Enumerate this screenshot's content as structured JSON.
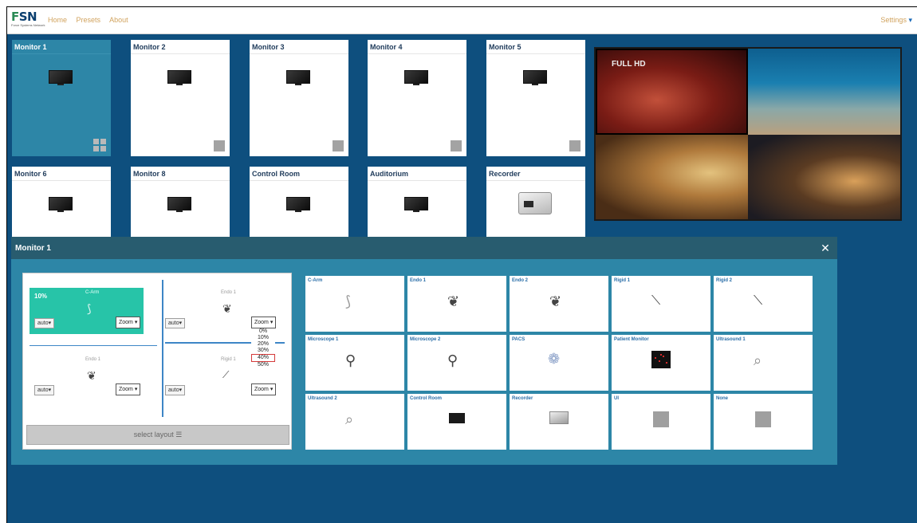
{
  "nav": {
    "logo": "FSN",
    "logo_sub": "Force Systems Network",
    "links": [
      "Home",
      "Presets",
      "About"
    ],
    "settings_label": "Settings"
  },
  "monitors": [
    {
      "label": "Monitor 1"
    },
    {
      "label": "Monitor 2"
    },
    {
      "label": "Monitor 3"
    },
    {
      "label": "Monitor 4"
    },
    {
      "label": "Monitor 5"
    },
    {
      "label": "Monitor 6"
    },
    {
      "label": "Monitor 8"
    },
    {
      "label": "Control Room"
    },
    {
      "label": "Auditorium"
    },
    {
      "label": "Recorder"
    }
  ],
  "preview": {
    "overlay_text": "FULL HD"
  },
  "panel": {
    "title": "Monitor 1",
    "close_icon": "✕",
    "quadrants": [
      {
        "zoom_pct": "10%",
        "source": "C-Arm",
        "auto_label": "auto",
        "zoom_label": "Zoom"
      },
      {
        "source": "Endo 1",
        "auto_label": "auto",
        "zoom_label": "Zoom"
      },
      {
        "source": "Endo 1",
        "auto_label": "auto",
        "zoom_label": "Zoom"
      },
      {
        "source": "Rigid 1",
        "auto_label": "auto",
        "zoom_label": "Zoom"
      }
    ],
    "zoom_options": [
      "0%",
      "10%",
      "20%",
      "30%",
      "40%",
      "50%"
    ],
    "zoom_highlighted": "40%",
    "select_layout_label": "select layout",
    "sources": [
      {
        "label": "C-Arm",
        "icon": "c-arm-icon"
      },
      {
        "label": "Endo 1",
        "icon": "endoscope-icon"
      },
      {
        "label": "Endo 2",
        "icon": "endoscope-icon"
      },
      {
        "label": "Rigid 1",
        "icon": "rigid-scope-icon"
      },
      {
        "label": "Rigid 2",
        "icon": "rigid-scope-icon"
      },
      {
        "label": "Microscope 1",
        "icon": "microscope-icon"
      },
      {
        "label": "Microscope 2",
        "icon": "microscope-icon"
      },
      {
        "label": "PACS",
        "icon": "xray-icon"
      },
      {
        "label": "Patient Monitor",
        "icon": "patient-monitor-icon"
      },
      {
        "label": "Ultrasound 1",
        "icon": "ultrasound-probe-icon"
      },
      {
        "label": "Ultrasound 2",
        "icon": "ultrasound-probe-icon"
      },
      {
        "label": "Control Room",
        "icon": "monitor-icon"
      },
      {
        "label": "Recorder",
        "icon": "recorder-icon"
      },
      {
        "label": "UI",
        "icon": "placeholder-icon"
      },
      {
        "label": "None",
        "icon": "placeholder-icon"
      }
    ]
  }
}
